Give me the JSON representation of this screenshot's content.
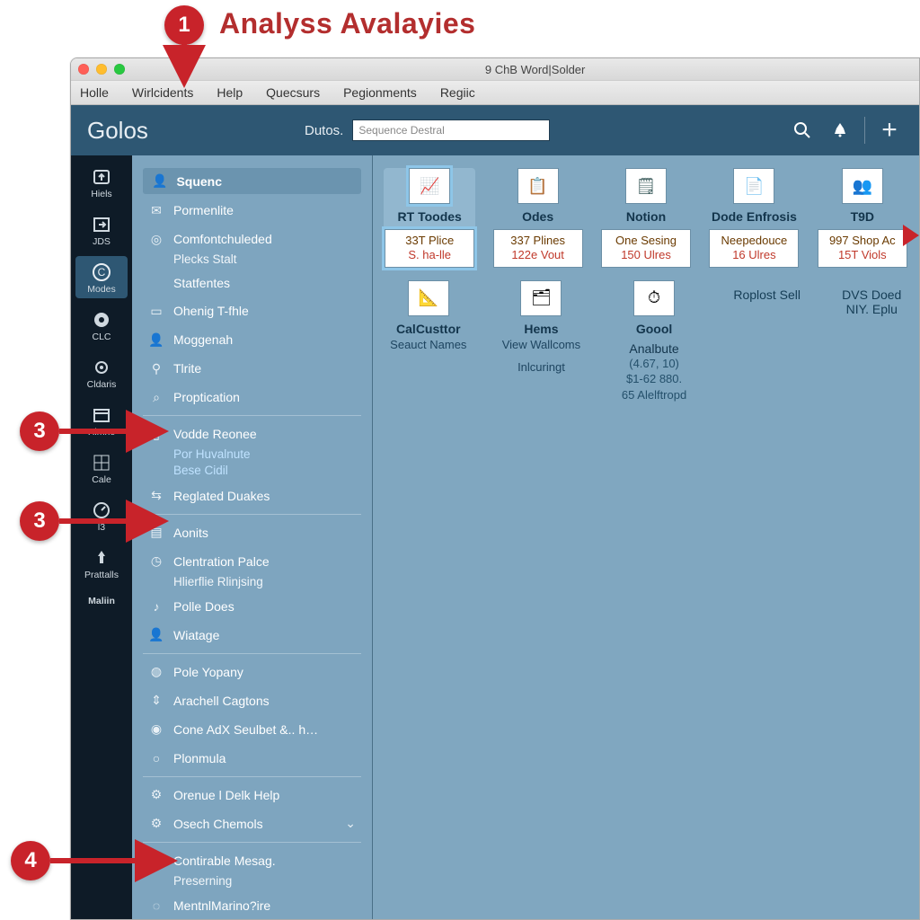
{
  "annotation": {
    "title": "Analyss Avalayies",
    "callouts": [
      "1",
      "3",
      "3",
      "4"
    ]
  },
  "window": {
    "title": "9 ChB Word|Solder",
    "menu": [
      "Holle",
      "Wirlcidents",
      "Help",
      "Quecsurs",
      "Pegionments",
      "Regiic"
    ]
  },
  "appbar": {
    "title": "Golos",
    "dutos": "Dutos.",
    "search_placeholder": "Sequence Destral",
    "icons": {
      "search": "search-icon",
      "notify": "bell-icon",
      "add": "plus-icon"
    }
  },
  "rail": [
    {
      "label": "Hiels",
      "icon": "upload"
    },
    {
      "label": "JDS",
      "icon": "export"
    },
    {
      "label": "Modes",
      "icon": "circle-c",
      "active": true
    },
    {
      "label": "CLC",
      "icon": "disc"
    },
    {
      "label": "Cldaris",
      "icon": "gear"
    },
    {
      "label": "Himne",
      "icon": "calendar"
    },
    {
      "label": "Cale",
      "icon": "grid"
    },
    {
      "label": "l3",
      "icon": "dial"
    },
    {
      "label": "Prattalls",
      "icon": "pin"
    },
    {
      "label": "Maliin",
      "icon": "text"
    }
  ],
  "sidepanel": {
    "header": "Squenc",
    "items": [
      {
        "icon": "mail",
        "label": "Pormenlite"
      },
      {
        "icon": "target",
        "label": "Comfontchuleded",
        "sub": [
          "Plecks Stalt"
        ]
      },
      {
        "icon": "",
        "label": "Statfentes",
        "indent": true
      },
      {
        "icon": "folder",
        "label": "Ohenig T-fhle"
      },
      {
        "icon": "person",
        "label": "Moggenah"
      },
      {
        "icon": "pin",
        "label": "Tlrite"
      },
      {
        "icon": "search",
        "label": "Proptication"
      },
      {
        "divider": true
      },
      {
        "icon": "doc",
        "label": "Vodde Reonee",
        "sub_hl": [
          "Por Huvalnute",
          "Bese Cidil"
        ]
      },
      {
        "icon": "link",
        "label": "Reglated Duakes"
      },
      {
        "divider": true
      },
      {
        "icon": "chart",
        "label": "Aonits"
      },
      {
        "icon": "clock",
        "label": "Clentration Palce",
        "sub": [
          "Hlierflie Rlinjsing"
        ]
      },
      {
        "icon": "note",
        "label": "Polle Does"
      },
      {
        "icon": "person",
        "label": "Wiatage"
      },
      {
        "divider": true
      },
      {
        "icon": "globe",
        "label": "Pole Yopany"
      },
      {
        "icon": "updown",
        "label": "Arachell Cagtons"
      },
      {
        "icon": "bulb",
        "label": "Cone AdX Seulbet &.. h…"
      },
      {
        "icon": "ring",
        "label": "Plonmula"
      },
      {
        "divider": true
      },
      {
        "icon": "gear",
        "label": "Orenue l Delk Help"
      },
      {
        "icon": "gear",
        "label": "Osech Chemols",
        "chev": true
      },
      {
        "divider": true
      },
      {
        "icon": "inbox",
        "label": "Contirable Mesag.",
        "sub": [
          "Preserning"
        ]
      },
      {
        "icon": "ring",
        "label": "MentnlMarino?ire"
      }
    ]
  },
  "main": {
    "cards": [
      {
        "label": "RT Toodes",
        "m1": "33T Plice",
        "m2": "S. ha-lle",
        "selected": true
      },
      {
        "label": "Odes",
        "m1": "337 Plines",
        "m2": "122e Vout"
      },
      {
        "label": "Notion",
        "m1": "One Sesing",
        "m2": "150 Ulres"
      },
      {
        "label": "Dode Enfrosis",
        "m1": "Neepedouce",
        "m2": "16 Ulres"
      },
      {
        "label": "T9D",
        "m1": "997 Shop Ac",
        "m2": "15T Viols"
      }
    ],
    "tools": [
      {
        "label": "CalCusttor",
        "sub": "Seauct Names"
      },
      {
        "label": "Hems",
        "sub": "View Wallcoms",
        "sub2": "Inlcuringt"
      },
      {
        "label": "Goool",
        "label2": "Analbute",
        "lines": [
          "(4.67, 10)",
          "$1-62 880.",
          "65 Alelftropd"
        ]
      }
    ],
    "rightlinks": [
      "Roplost Sell",
      "DVS Doed ",
      "NIY. Eplu"
    ]
  }
}
